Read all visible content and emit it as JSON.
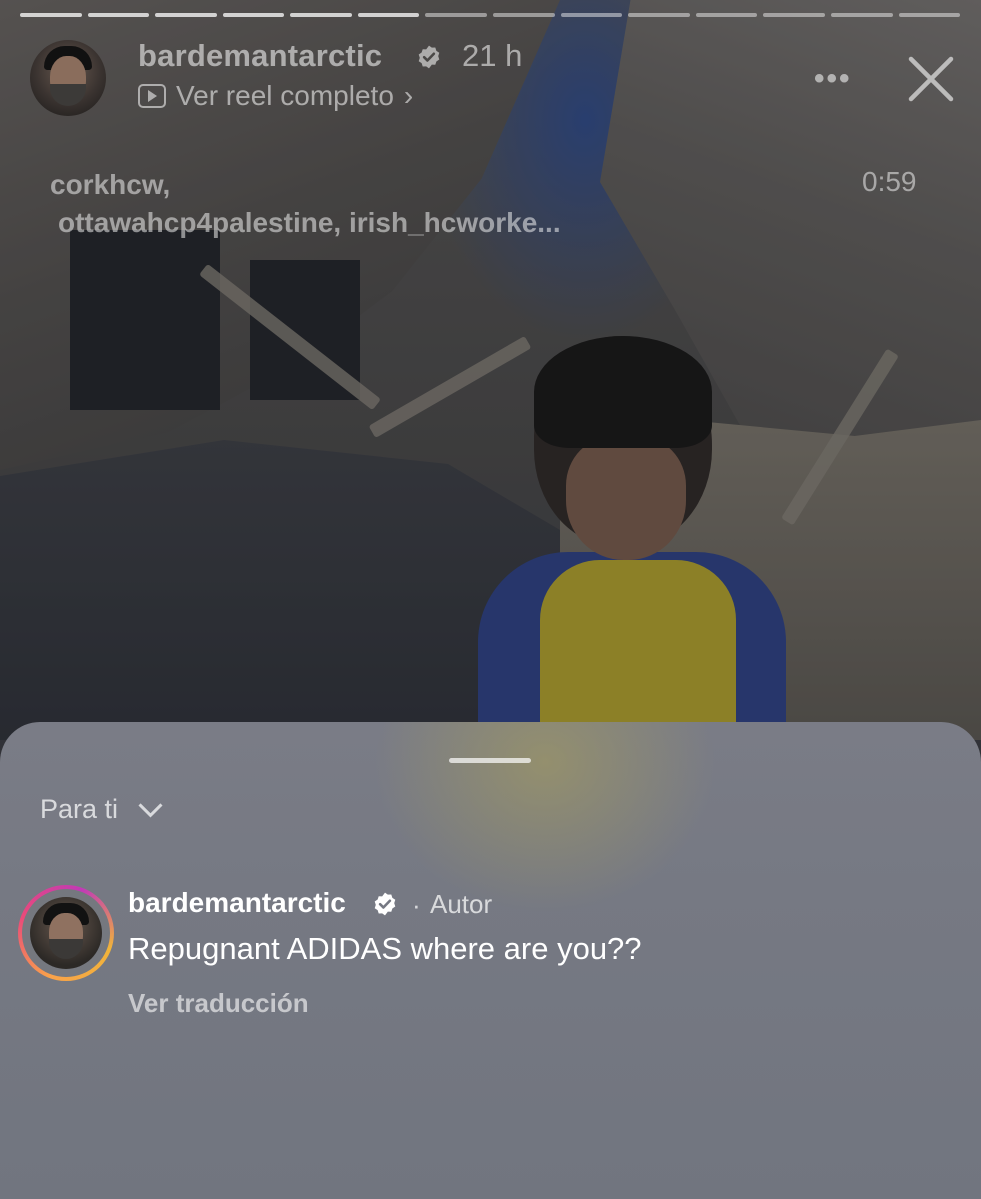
{
  "story": {
    "segments_total": 14,
    "segments_done": 6,
    "author": "bardemantarctic",
    "age": "21 h",
    "reel_link": "Ver reel completo",
    "reel_chevron": "›",
    "more_label": "•••",
    "tags": [
      "corkhcw,",
      "ottawahcp4palestine, irish_hcworke..."
    ],
    "duration": "0:59"
  },
  "comments_sheet": {
    "filter_label": "Para ti",
    "comments": [
      {
        "username": "bardemantarctic",
        "separator": "·",
        "badge": "Autor",
        "text": "Repugnant ADIDAS where are you??",
        "translate_label": "Ver traducción"
      }
    ]
  },
  "icons": {
    "verified": "verified-badge-icon",
    "reel": "play-icon",
    "more": "more-icon",
    "close": "close-icon",
    "filter": "chevron-down-icon"
  }
}
